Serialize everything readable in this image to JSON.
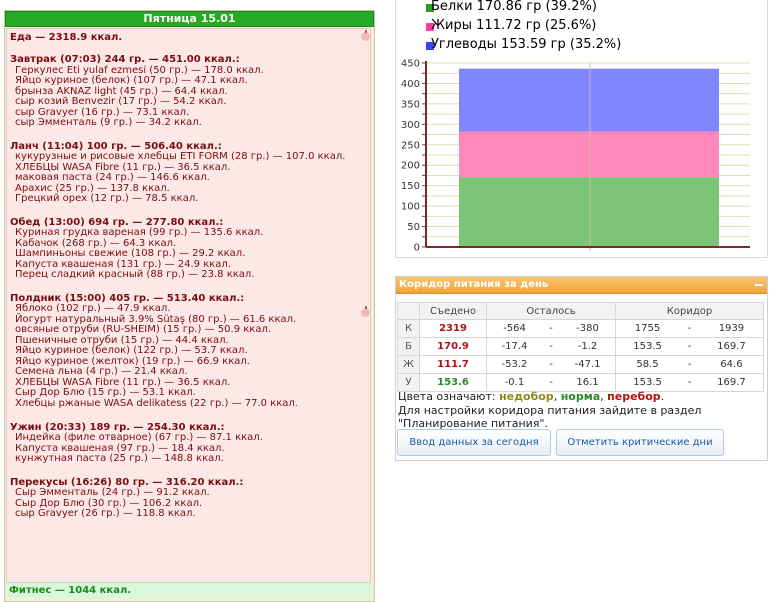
{
  "day_header": "Пятница 15.01",
  "food_total": "Еда — 2318.9 ккал.",
  "meals": [
    {
      "title": "Завтрак (07:03) 244 гр. — 451.00 ккал.:",
      "items": [
        "Геркулес Eti yulaf ezmesi (50 гр.) — 178.0 ккал.",
        "Яйцо куриное (белок) (107 гр.) — 47.1 ккал.",
        "брынза AKNAZ light (45 гр.) — 64.4 ккал.",
        "сыр козий Benvezir (17 гр.) — 54.2 ккал.",
        "сыр Gravyer (16 гр.) — 73.1 ккал.",
        "сыр Эмменталь (9 гр.) — 34.2 ккал."
      ]
    },
    {
      "title": "Ланч (11:04) 100 гр. — 506.40 ккал.:",
      "items": [
        "кукурузные и рисовые хлебцы ETI FORM (28 гр.) — 107.0 ккал.",
        "ХЛЕБЦЫ WASA Fibre (11 гр.) — 36.5 ккал.",
        "маковая паста (24 гр.) — 146.6 ккал.",
        "Арахис (25 гр.) — 137.8 ккал.",
        "Грецкий орех (12 гр.) — 78.5 ккал."
      ]
    },
    {
      "title": "Обед (13:00) 694 гр. — 277.80 ккал.:",
      "items": [
        "Куриная грудка вареная (99 гр.) — 135.6 ккал.",
        "Кабачок (268 гр.) — 64.3 ккал.",
        "Шампиньоны свежие (108 гр.) — 29.2 ккал.",
        "Капуста квашеная (131 гр.) — 24.9 ккал.",
        "Перец сладкий красный (88 гр.) — 23.8 ккал."
      ]
    },
    {
      "title": "Полдник (15:00) 405 гр. — 513.40 ккал.:",
      "items": [
        "Яблоко (102 гр.) — 47.9 ккал.",
        "Йогурт натуральный 3.9% Sütaş (80 гр.) — 61.6 ккал.",
        "овсяные отруби (RU-SHEIM) (15 гр.) — 50.9 ккал.",
        "Пшеничные отруби (15 гр.) — 44.4 ккал.",
        "Яйцо куриное (белок) (122 гр.) — 53.7 ккал.",
        "Яйцо куриное (желток) (19 гр.) — 66.9 ккал.",
        "Семена льна (4 гр.) — 21.4 ккал.",
        "ХЛЕБЦЫ WASA Fibre (11 гр.) — 36.5 ккал.",
        "Сыр Дор Блю (15 гр.) — 53.1 ккал.",
        "Хлебцы ржаные WASA delikatess (22 гр.) — 77.0 ккал."
      ]
    },
    {
      "title": "Ужин (20:33) 189 гр. — 254.30 ккал.:",
      "items": [
        "Индейка (филе отварное) (67 гр.) — 87.1 ккал.",
        "Капуста квашеная (97 гр.) — 18.4 ккал.",
        "кунжутная паста (25 гр.) — 148.8 ккал."
      ]
    },
    {
      "title": "Перекусы (16:26) 80 гр. — 316.20 ккал.:",
      "items": [
        "Сыр Эмменталь (24 гр.) — 91.2 ккал.",
        "Сыр Дор Блю (30 гр.) — 106.2 ккал.",
        "сыр Gravyer (26 гр.) — 118.8 ккал."
      ]
    }
  ],
  "fitness": "Фитнес — 1044 ккал.",
  "chart_data": {
    "type": "bar",
    "categories": [
      ""
    ],
    "stacked": true,
    "series": [
      {
        "name": "Белки 170.86 гр (39.2%)",
        "values": [
          170.86
        ],
        "color": "#7cc576"
      },
      {
        "name": "Жиры 111.72 гр (25.6%)",
        "values": [
          111.72
        ],
        "color": "#ff88bb"
      },
      {
        "name": "Углеводы 153.59 гр (35.2%)",
        "values": [
          153.59
        ],
        "color": "#7f86ff"
      }
    ],
    "legend_colors": [
      "#2e9a26",
      "#ff3aa0",
      "#3a42ff"
    ],
    "yticks": [
      0,
      25,
      50,
      75,
      100,
      125,
      150,
      175,
      200,
      225,
      250,
      275,
      300,
      325,
      350,
      375,
      400,
      425,
      450
    ],
    "ylim": [
      0,
      450
    ],
    "grid": true,
    "legend_position": "top-left"
  },
  "corridor": {
    "title": "Коридор питания за день",
    "headers": [
      "",
      "Съедено",
      "Осталось",
      "Коридор"
    ],
    "rows": [
      {
        "label": "К",
        "eaten": "2319",
        "eaten_color": "#b21212",
        "rem1": "-564",
        "rem2": "-380",
        "cor1": "1755",
        "cor2": "1939"
      },
      {
        "label": "Б",
        "eaten": "170.9",
        "eaten_color": "#b21212",
        "rem1": "-17.4",
        "rem2": "-1.2",
        "cor1": "153.5",
        "cor2": "169.7"
      },
      {
        "label": "Ж",
        "eaten": "111.7",
        "eaten_color": "#b21212",
        "rem1": "-53.2",
        "rem2": "-47.1",
        "cor1": "58.5",
        "cor2": "64.6"
      },
      {
        "label": "У",
        "eaten": "153.6",
        "eaten_color": "#2a8a2a",
        "rem1": "-0.1",
        "rem2": "16.1",
        "cor1": "153.5",
        "cor2": "169.7"
      }
    ],
    "dash": "-",
    "colors_prefix": "Цвета означают:",
    "color_under": "недобор",
    "color_norm": "норма",
    "color_over": "перебор",
    "color_under_hex": "#8a8a1a",
    "color_norm_hex": "#2a8a2a",
    "color_over_hex": "#b21212",
    "note_line1": "Для настройки коридора питания зайдите в раздел",
    "note_line2": "\"Планирование питания\".",
    "btn_today": "Ввод данных за сегодня",
    "btn_critical": "Отметить критические дни"
  }
}
